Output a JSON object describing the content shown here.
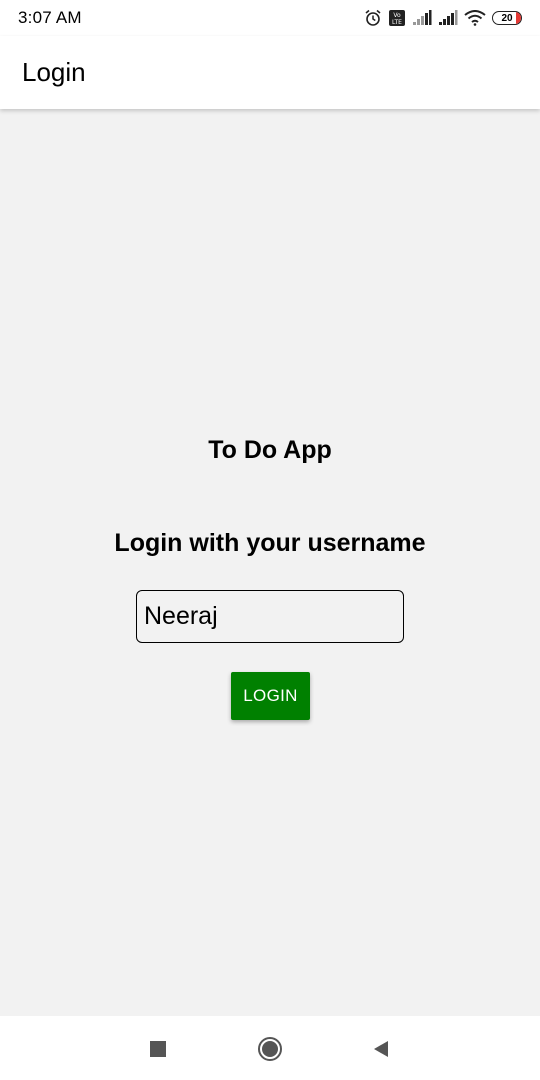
{
  "status_bar": {
    "time": "3:07 AM",
    "battery_level": "20",
    "volte_label": "Vo LTE",
    "icons": [
      "alarm-icon",
      "volte-icon",
      "signal-icon",
      "signal-icon",
      "wifi-icon",
      "battery-icon"
    ]
  },
  "app_bar": {
    "title": "Login"
  },
  "main": {
    "app_title": "To Do App",
    "login_prompt": "Login with your username",
    "username": {
      "value": "Neeraj"
    },
    "login_button_label": "LOGIN"
  },
  "colors": {
    "accent": "#008000",
    "background": "#f2f2f2",
    "battery_low": "#e53935"
  },
  "nav_bar": {
    "icons": [
      "recent-apps-icon",
      "home-icon",
      "back-icon"
    ]
  }
}
